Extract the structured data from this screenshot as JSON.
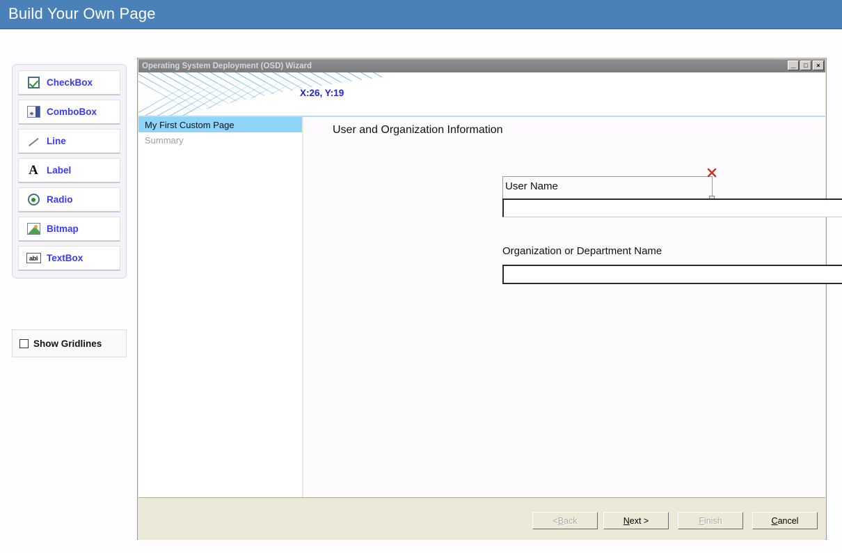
{
  "app": {
    "header_title": "Build Your Own Page"
  },
  "toolbox": {
    "items": [
      {
        "label": "CheckBox",
        "icon": "checkbox-icon"
      },
      {
        "label": "ComboBox",
        "icon": "combobox-icon"
      },
      {
        "label": "Line",
        "icon": "line-icon"
      },
      {
        "label": "Label",
        "icon": "label-icon"
      },
      {
        "label": "Radio",
        "icon": "radio-icon"
      },
      {
        "label": "Bitmap",
        "icon": "bitmap-icon"
      },
      {
        "label": "TextBox",
        "icon": "textbox-icon"
      }
    ],
    "gridlines": {
      "label": "Show Gridlines",
      "checked": false
    }
  },
  "wizard": {
    "title": "Operating System Deployment (OSD) Wizard",
    "window_controls": {
      "minimize": "_",
      "maximize": "□",
      "close": "×"
    },
    "banner": {
      "coordinates": "X:26, Y:19"
    },
    "nav": {
      "items": [
        {
          "label": "My First Custom Page",
          "state": "current"
        },
        {
          "label": "Summary",
          "state": "pending"
        }
      ]
    },
    "content": {
      "heading": "User and Organization Information",
      "controls": {
        "user_name_label": "User Name",
        "user_name_value": "",
        "user_name_placeholder": "",
        "organization_label": "Organization or Department Name",
        "organization_value": "",
        "organization_placeholder": ""
      }
    },
    "buttons": [
      {
        "prefix": "< ",
        "mnemonic": "B",
        "suffix": "ack",
        "enabled": false
      },
      {
        "prefix": "",
        "mnemonic": "N",
        "suffix": "ext >",
        "enabled": true
      },
      {
        "prefix": "",
        "mnemonic": "F",
        "suffix": "inish",
        "enabled": false
      },
      {
        "prefix": "",
        "mnemonic": "C",
        "suffix": "ancel",
        "enabled": true
      }
    ]
  },
  "colors": {
    "header_bar": "#4a81b8",
    "tool_label": "#3a3af0",
    "nav_selected": "#8fd4f9",
    "coord_text": "#2222dd",
    "delete_marker": "#c0392b",
    "window_chrome": "#ece9d8"
  }
}
